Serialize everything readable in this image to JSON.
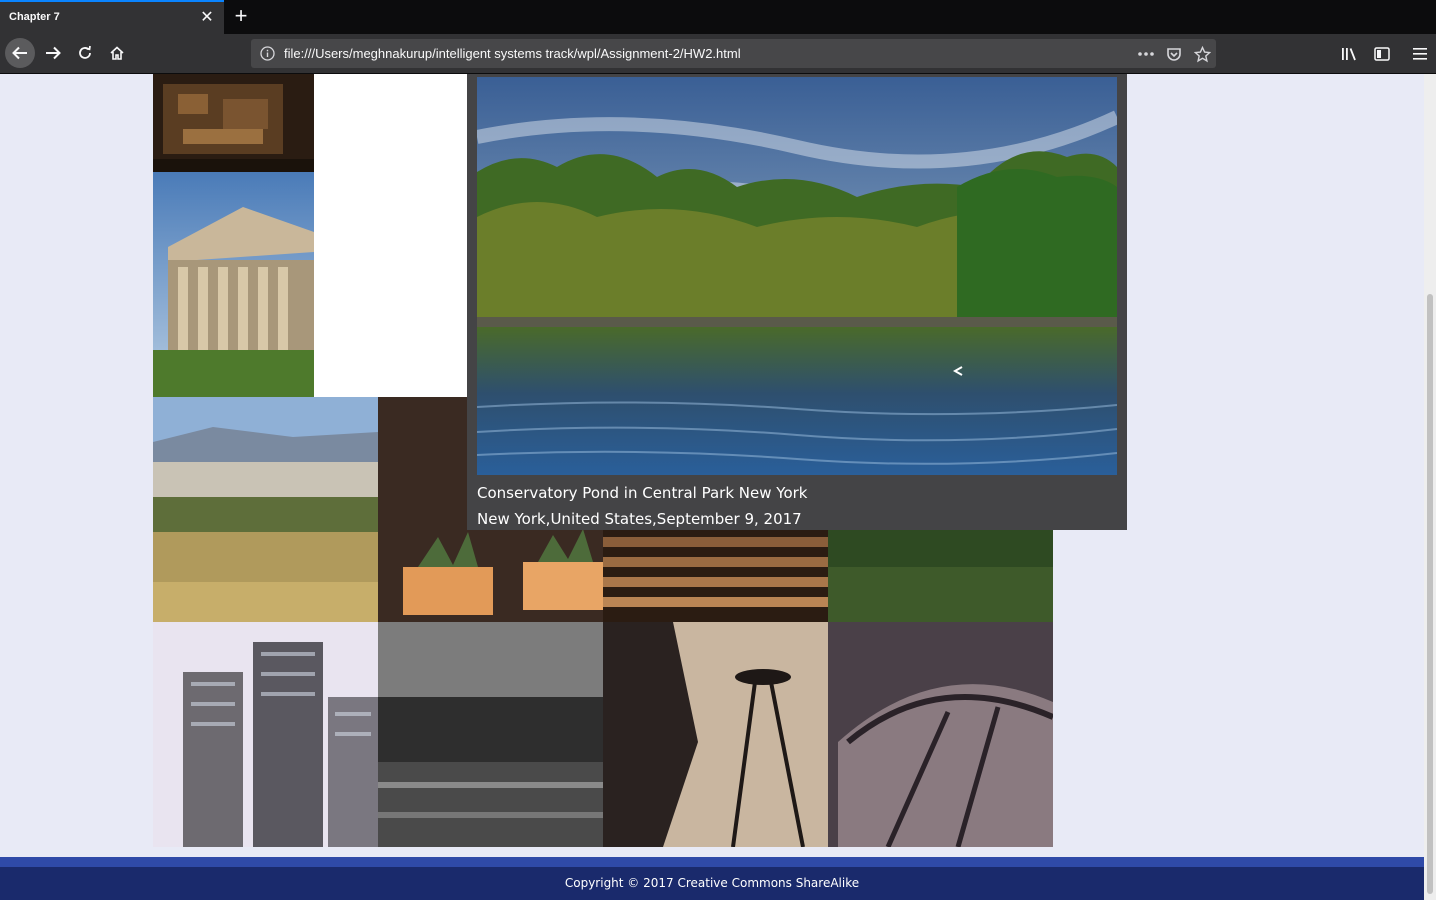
{
  "browser": {
    "tab_title": "Chapter 7",
    "tab_close": "✕",
    "new_tab": "+",
    "url": "file:///Users/meghnakurup/intelligent systems track/wpl/Assignment-2/HW2.html",
    "icons": {
      "back": "back-arrow-icon",
      "forward": "forward-arrow-icon",
      "reload": "reload-icon",
      "home": "home-icon",
      "info": "info-icon",
      "more": "more-actions-icon",
      "pocket": "pocket-icon",
      "bookmark": "bookmark-star-icon",
      "library": "library-icon",
      "sidebar": "sidebar-icon",
      "menu": "hamburger-menu-icon"
    },
    "accent_color": "#0a84ff"
  },
  "gallery": {
    "popup": {
      "title": "Conservatory Pond in Central Park New York",
      "subtitle": "New York,United States,September 9, 2017"
    },
    "tiles": [
      {
        "name": "ruins-aerial-photo"
      },
      {
        "name": "greek-temple-photo"
      },
      {
        "name": "ancient-city-hillside-photo"
      },
      {
        "name": "planters-photo"
      },
      {
        "name": "stairs-photo"
      },
      {
        "name": "city-skyline-photo"
      },
      {
        "name": "office-towers-photo"
      },
      {
        "name": "bw-pond-photo"
      },
      {
        "name": "space-needle-photo"
      },
      {
        "name": "curved-building-photo"
      },
      {
        "name": "american-building-photo"
      },
      {
        "name": "florence-dome-photo"
      }
    ]
  },
  "footer": {
    "copyright": "Copyright © 2017 Creative Commons ShareAlike"
  }
}
